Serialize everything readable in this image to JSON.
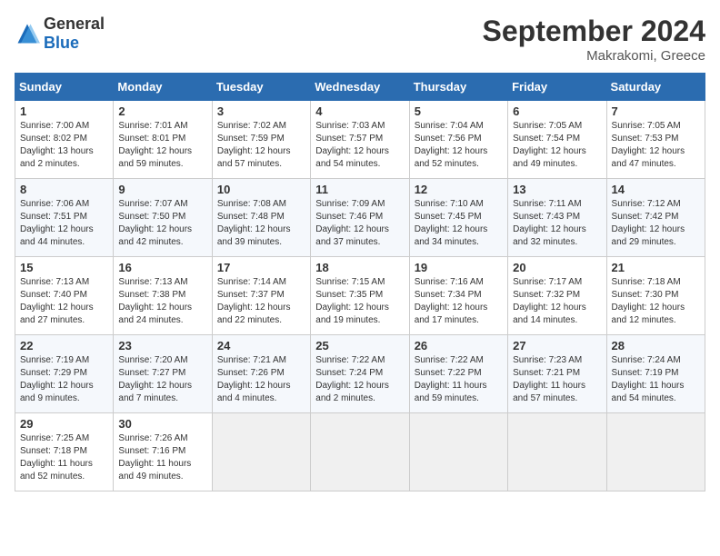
{
  "header": {
    "logo_general": "General",
    "logo_blue": "Blue",
    "month": "September 2024",
    "location": "Makrakomi, Greece"
  },
  "columns": [
    "Sunday",
    "Monday",
    "Tuesday",
    "Wednesday",
    "Thursday",
    "Friday",
    "Saturday"
  ],
  "weeks": [
    [
      {
        "day": "1",
        "lines": [
          "Sunrise: 7:00 AM",
          "Sunset: 8:02 PM",
          "Daylight: 13 hours",
          "and 2 minutes."
        ]
      },
      {
        "day": "2",
        "lines": [
          "Sunrise: 7:01 AM",
          "Sunset: 8:01 PM",
          "Daylight: 12 hours",
          "and 59 minutes."
        ]
      },
      {
        "day": "3",
        "lines": [
          "Sunrise: 7:02 AM",
          "Sunset: 7:59 PM",
          "Daylight: 12 hours",
          "and 57 minutes."
        ]
      },
      {
        "day": "4",
        "lines": [
          "Sunrise: 7:03 AM",
          "Sunset: 7:57 PM",
          "Daylight: 12 hours",
          "and 54 minutes."
        ]
      },
      {
        "day": "5",
        "lines": [
          "Sunrise: 7:04 AM",
          "Sunset: 7:56 PM",
          "Daylight: 12 hours",
          "and 52 minutes."
        ]
      },
      {
        "day": "6",
        "lines": [
          "Sunrise: 7:05 AM",
          "Sunset: 7:54 PM",
          "Daylight: 12 hours",
          "and 49 minutes."
        ]
      },
      {
        "day": "7",
        "lines": [
          "Sunrise: 7:05 AM",
          "Sunset: 7:53 PM",
          "Daylight: 12 hours",
          "and 47 minutes."
        ]
      }
    ],
    [
      {
        "day": "8",
        "lines": [
          "Sunrise: 7:06 AM",
          "Sunset: 7:51 PM",
          "Daylight: 12 hours",
          "and 44 minutes."
        ]
      },
      {
        "day": "9",
        "lines": [
          "Sunrise: 7:07 AM",
          "Sunset: 7:50 PM",
          "Daylight: 12 hours",
          "and 42 minutes."
        ]
      },
      {
        "day": "10",
        "lines": [
          "Sunrise: 7:08 AM",
          "Sunset: 7:48 PM",
          "Daylight: 12 hours",
          "and 39 minutes."
        ]
      },
      {
        "day": "11",
        "lines": [
          "Sunrise: 7:09 AM",
          "Sunset: 7:46 PM",
          "Daylight: 12 hours",
          "and 37 minutes."
        ]
      },
      {
        "day": "12",
        "lines": [
          "Sunrise: 7:10 AM",
          "Sunset: 7:45 PM",
          "Daylight: 12 hours",
          "and 34 minutes."
        ]
      },
      {
        "day": "13",
        "lines": [
          "Sunrise: 7:11 AM",
          "Sunset: 7:43 PM",
          "Daylight: 12 hours",
          "and 32 minutes."
        ]
      },
      {
        "day": "14",
        "lines": [
          "Sunrise: 7:12 AM",
          "Sunset: 7:42 PM",
          "Daylight: 12 hours",
          "and 29 minutes."
        ]
      }
    ],
    [
      {
        "day": "15",
        "lines": [
          "Sunrise: 7:13 AM",
          "Sunset: 7:40 PM",
          "Daylight: 12 hours",
          "and 27 minutes."
        ]
      },
      {
        "day": "16",
        "lines": [
          "Sunrise: 7:13 AM",
          "Sunset: 7:38 PM",
          "Daylight: 12 hours",
          "and 24 minutes."
        ]
      },
      {
        "day": "17",
        "lines": [
          "Sunrise: 7:14 AM",
          "Sunset: 7:37 PM",
          "Daylight: 12 hours",
          "and 22 minutes."
        ]
      },
      {
        "day": "18",
        "lines": [
          "Sunrise: 7:15 AM",
          "Sunset: 7:35 PM",
          "Daylight: 12 hours",
          "and 19 minutes."
        ]
      },
      {
        "day": "19",
        "lines": [
          "Sunrise: 7:16 AM",
          "Sunset: 7:34 PM",
          "Daylight: 12 hours",
          "and 17 minutes."
        ]
      },
      {
        "day": "20",
        "lines": [
          "Sunrise: 7:17 AM",
          "Sunset: 7:32 PM",
          "Daylight: 12 hours",
          "and 14 minutes."
        ]
      },
      {
        "day": "21",
        "lines": [
          "Sunrise: 7:18 AM",
          "Sunset: 7:30 PM",
          "Daylight: 12 hours",
          "and 12 minutes."
        ]
      }
    ],
    [
      {
        "day": "22",
        "lines": [
          "Sunrise: 7:19 AM",
          "Sunset: 7:29 PM",
          "Daylight: 12 hours",
          "and 9 minutes."
        ]
      },
      {
        "day": "23",
        "lines": [
          "Sunrise: 7:20 AM",
          "Sunset: 7:27 PM",
          "Daylight: 12 hours",
          "and 7 minutes."
        ]
      },
      {
        "day": "24",
        "lines": [
          "Sunrise: 7:21 AM",
          "Sunset: 7:26 PM",
          "Daylight: 12 hours",
          "and 4 minutes."
        ]
      },
      {
        "day": "25",
        "lines": [
          "Sunrise: 7:22 AM",
          "Sunset: 7:24 PM",
          "Daylight: 12 hours",
          "and 2 minutes."
        ]
      },
      {
        "day": "26",
        "lines": [
          "Sunrise: 7:22 AM",
          "Sunset: 7:22 PM",
          "Daylight: 11 hours",
          "and 59 minutes."
        ]
      },
      {
        "day": "27",
        "lines": [
          "Sunrise: 7:23 AM",
          "Sunset: 7:21 PM",
          "Daylight: 11 hours",
          "and 57 minutes."
        ]
      },
      {
        "day": "28",
        "lines": [
          "Sunrise: 7:24 AM",
          "Sunset: 7:19 PM",
          "Daylight: 11 hours",
          "and 54 minutes."
        ]
      }
    ],
    [
      {
        "day": "29",
        "lines": [
          "Sunrise: 7:25 AM",
          "Sunset: 7:18 PM",
          "Daylight: 11 hours",
          "and 52 minutes."
        ]
      },
      {
        "day": "30",
        "lines": [
          "Sunrise: 7:26 AM",
          "Sunset: 7:16 PM",
          "Daylight: 11 hours",
          "and 49 minutes."
        ]
      },
      {
        "day": "",
        "lines": []
      },
      {
        "day": "",
        "lines": []
      },
      {
        "day": "",
        "lines": []
      },
      {
        "day": "",
        "lines": []
      },
      {
        "day": "",
        "lines": []
      }
    ]
  ]
}
